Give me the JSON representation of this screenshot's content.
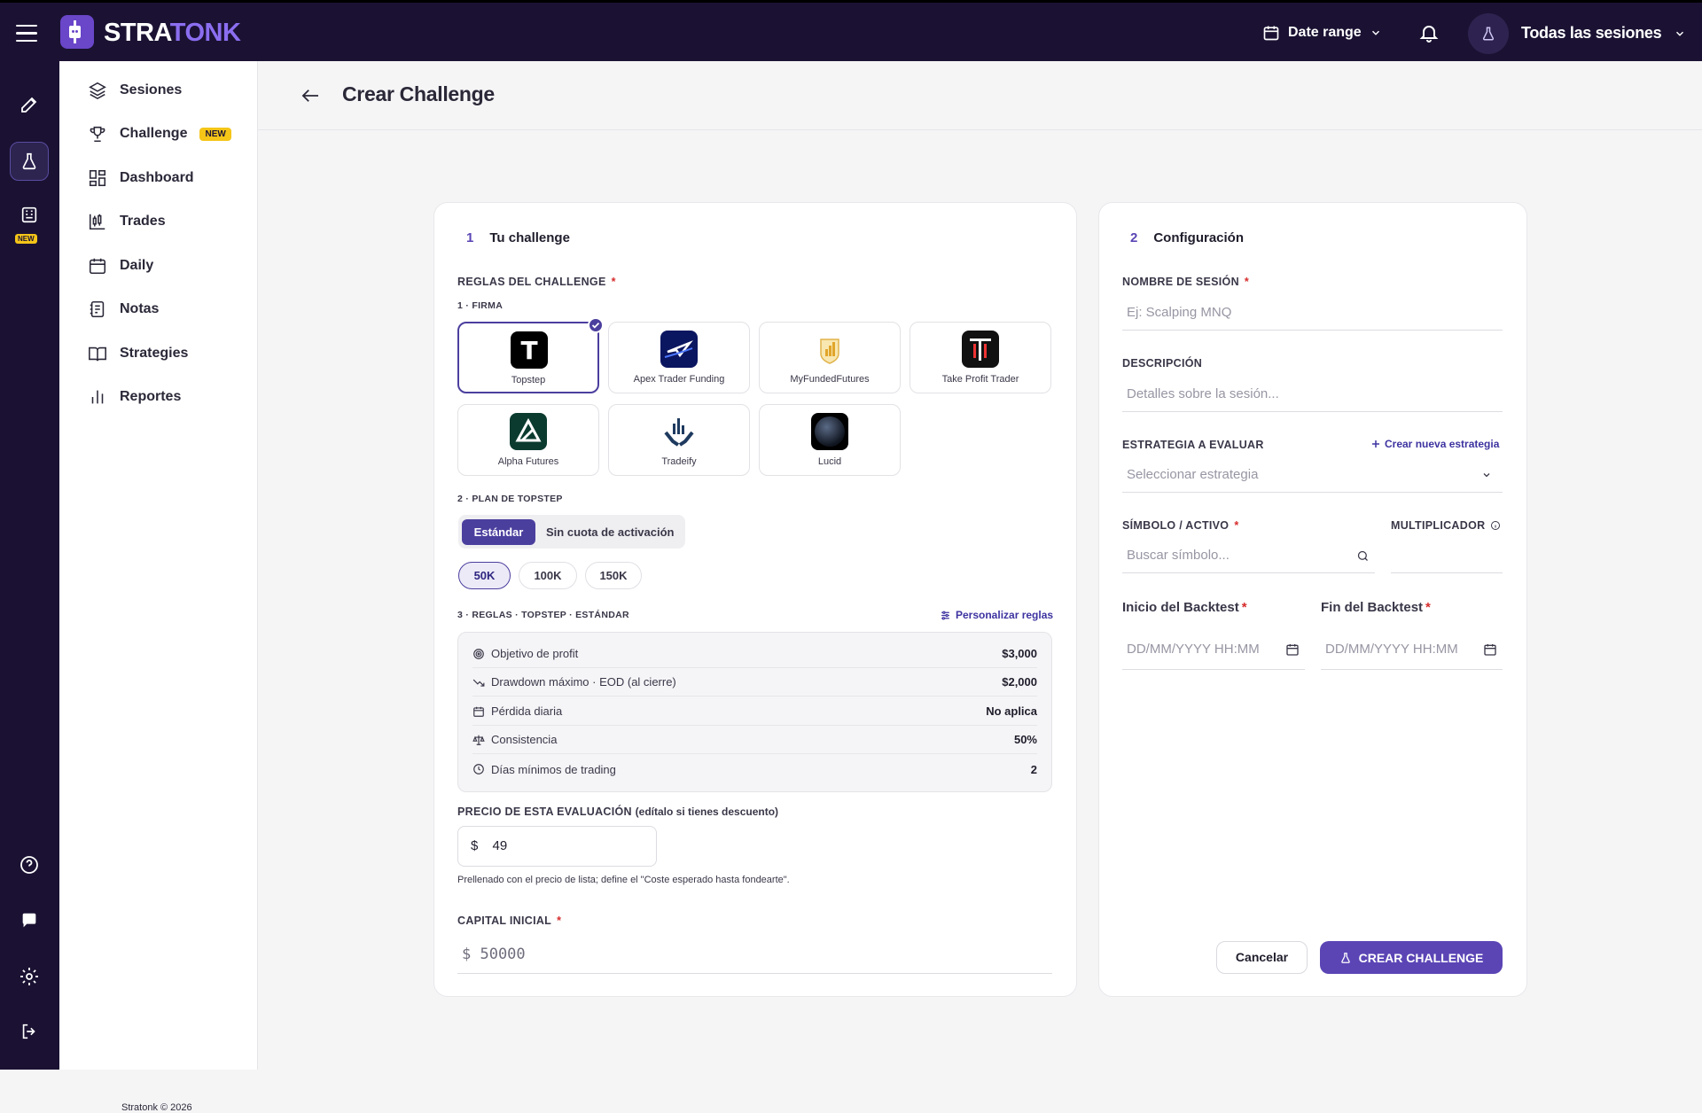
{
  "app": {
    "brand_part1": "STRA",
    "brand_part2": "TONK"
  },
  "topbar": {
    "date_range": "Date range",
    "session_selector": "Todas las sesiones"
  },
  "rail": {
    "new_badge": "NEW"
  },
  "sidebar": {
    "items": [
      {
        "label": "Sesiones",
        "icon": "layers-icon"
      },
      {
        "label": "Challenge",
        "icon": "trophy-icon",
        "badge": "NEW"
      },
      {
        "label": "Dashboard",
        "icon": "dashboard-icon"
      },
      {
        "label": "Trades",
        "icon": "candles-icon"
      },
      {
        "label": "Daily",
        "icon": "calendar-icon"
      },
      {
        "label": "Notas",
        "icon": "notes-icon"
      },
      {
        "label": "Strategies",
        "icon": "book-icon"
      },
      {
        "label": "Reportes",
        "icon": "bar-chart-icon"
      }
    ],
    "footer": "Stratonk © 2026"
  },
  "header": {
    "title": "Crear Challenge"
  },
  "left_card": {
    "step_num": "1",
    "step_title": "Tu challenge",
    "rules_label": "REGLAS DEL CHALLENGE",
    "firm_label": "1 · FIRMA",
    "firms": [
      {
        "name": "Topstep",
        "selected": true
      },
      {
        "name": "Apex Trader Funding",
        "selected": false
      },
      {
        "name": "MyFundedFutures",
        "selected": false
      },
      {
        "name": "Take Profit Trader",
        "selected": false
      },
      {
        "name": "Alpha Futures",
        "selected": false
      },
      {
        "name": "Tradeify",
        "selected": false
      },
      {
        "name": "Lucid",
        "selected": false
      }
    ],
    "plan_label": "2 · PLAN DE TOPSTEP",
    "plan_options": [
      "Estándar",
      "Sin cuota de activación"
    ],
    "plan_selected": "Estándar",
    "sizes": [
      "50K",
      "100K",
      "150K"
    ],
    "size_selected": "50K",
    "rules_section_label": "3 · REGLAS · TOPSTEP · ESTÁNDAR",
    "customize_link": "Personalizar reglas",
    "rules": [
      {
        "label": "Objetivo de profit",
        "value": "$3,000",
        "icon": "target-icon"
      },
      {
        "label": "Drawdown máximo · EOD (al cierre)",
        "value": "$2,000",
        "icon": "trend-down-icon"
      },
      {
        "label": "Pérdida diaria",
        "value": "No aplica",
        "icon": "calendar-icon"
      },
      {
        "label": "Consistencia",
        "value": "50%",
        "icon": "scale-icon"
      },
      {
        "label": "Días mínimos de trading",
        "value": "2",
        "icon": "clock-icon"
      }
    ],
    "price_label": "PRECIO DE ESTA EVALUACIÓN",
    "price_hint": "(edítalo si tienes descuento)",
    "price_currency": "$",
    "price_value": "49",
    "price_note": "Prellenado con el precio de lista; define el \"Coste esperado hasta fondearte\".",
    "capital_label": "CAPITAL INICIAL",
    "capital_placeholder": "$ 50000"
  },
  "right_card": {
    "step_num": "2",
    "step_title": "Configuración",
    "session_name_label": "NOMBRE DE SESIÓN",
    "session_name_placeholder": "Ej: Scalping MNQ",
    "description_label": "DESCRIPCIÓN",
    "description_placeholder": "Detalles sobre la sesión...",
    "strategy_label": "ESTRATEGIA A EVALUAR",
    "strategy_link": "Crear nueva estrategia",
    "strategy_placeholder": "Seleccionar estrategia",
    "symbol_label": "SÍMBOLO / ACTIVO",
    "symbol_placeholder": "Buscar símbolo...",
    "multiplier_label": "MULTIPLICADOR",
    "start_label": "Inicio del Backtest",
    "end_label": "Fin del Backtest",
    "date_placeholder": "DD/MM/YYYY HH:MM",
    "cancel": "Cancelar",
    "create": "CREAR CHALLENGE"
  },
  "colors": {
    "primary": "#5b45b5",
    "topbar": "#1b1233",
    "badge": "#f5c518",
    "required": "#d62c2c"
  }
}
